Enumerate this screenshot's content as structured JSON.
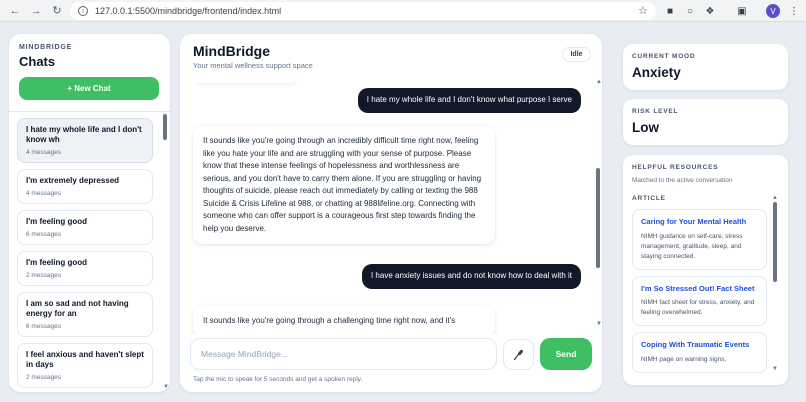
{
  "browser": {
    "url": "127.0.0.1:5500/mindbridge/frontend/index.html",
    "profile_initial": "V"
  },
  "sidebar": {
    "brand": "MINDBRIDGE",
    "title": "Chats",
    "new_chat_label": "+ New Chat",
    "items": [
      {
        "title": "I hate my whole life and I don't know wh",
        "meta": "4 messages",
        "active": true
      },
      {
        "title": "I'm extremely depressed",
        "meta": "4 messages"
      },
      {
        "title": "I'm feeling good",
        "meta": "6 messages"
      },
      {
        "title": "I'm feeling good",
        "meta": "2 messages"
      },
      {
        "title": "I am so sad and not having energy for an",
        "meta": "6 messages"
      },
      {
        "title": "I feel anxious and haven't slept in days",
        "meta": "2 messages"
      }
    ]
  },
  "header": {
    "title": "MindBridge",
    "subtitle": "Your mental wellness support space",
    "status": "Idle"
  },
  "messages": [
    {
      "role": "user",
      "text": "I hate my whole life and I don't know what purpose I serve"
    },
    {
      "role": "assistant",
      "text": "It sounds like you're going through an incredibly difficult time right now, feeling like you hate your life and are struggling with your sense of purpose. Please know that these intense feelings of hopelessness and worthlessness are serious, and you don't have to carry them alone. If you are struggling or having thoughts of suicide, please reach out immediately by calling or texting the 988 Suicide & Crisis Lifeline at 988, or chatting at 988lifeline.org. Connecting with someone who can offer support is a courageous first step towards finding the help you deserve."
    },
    {
      "role": "user",
      "text": "I have anxiety issues and do not know how to deal with it"
    },
    {
      "role": "assistant",
      "text": "It sounds like you're going through a challenging time right now, and it's"
    }
  ],
  "composer": {
    "placeholder": "Message MindBridge...",
    "send_label": "Send",
    "hint": "Tap the mic to speak for 5 seconds and get a spoken reply."
  },
  "mood": {
    "label": "CURRENT MOOD",
    "value": "Anxiety"
  },
  "risk": {
    "label": "RISK LEVEL",
    "value": "Low"
  },
  "resources": {
    "label": "HELPFUL RESOURCES",
    "subtitle": "Matched to the active conversation",
    "type_label": "ARTICLE",
    "items": [
      {
        "title": "Caring for Your Mental Health",
        "desc": "NIMH guidance on self-care, stress management, gratitude, sleep, and staying connected."
      },
      {
        "title": "I'm So Stressed Out! Fact Sheet",
        "desc": "NIMH fact sheet for stress, anxiety, and feeling overwhelmed."
      },
      {
        "title": "Coping With Traumatic Events",
        "desc": "NIMH page on warning signs,"
      }
    ]
  },
  "colors": {
    "accent": "#3fbf63",
    "user_bubble": "#111827",
    "link": "#1d4ed8"
  }
}
